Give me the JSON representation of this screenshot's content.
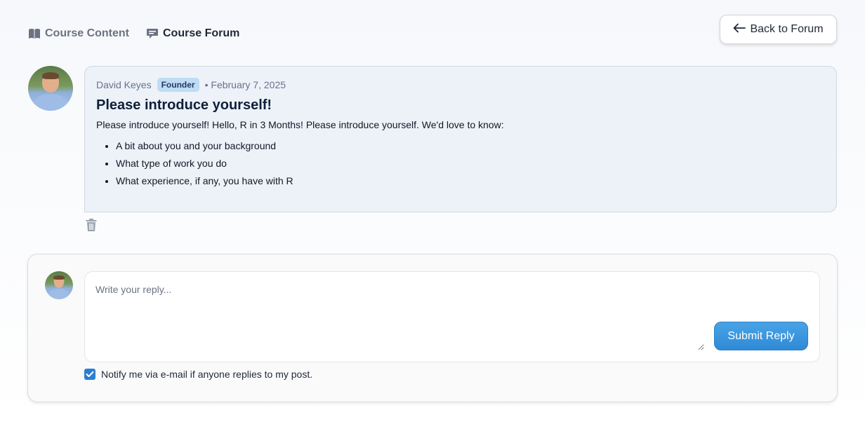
{
  "nav": {
    "course_content": "Course Content",
    "course_forum": "Course Forum",
    "back_to_forum": "Back to Forum"
  },
  "post": {
    "author": "David Keyes",
    "badge": "Founder",
    "date_separator": "•",
    "date": "February 7, 2025",
    "title": "Please introduce yourself!",
    "intro": "Please introduce yourself! Hello, R in 3 Months! Please introduce yourself. We'd love to know:",
    "bullets": [
      "A bit about you and your background",
      "What type of work you do",
      "What experience, if any, you have with R"
    ]
  },
  "reply": {
    "placeholder": "Write your reply...",
    "submit_label": "Submit Reply",
    "notify_label": "Notify me via e-mail if anyone replies to my post.",
    "notify_checked": true
  },
  "colors": {
    "accent": "#2f8ad6",
    "badge_bg": "#bfdcf5",
    "card_bg": "#edf2f8"
  },
  "icons": {
    "course_content": "book-icon",
    "course_forum": "chat-icon",
    "back": "arrow-left-icon",
    "delete": "trash-icon",
    "check": "check-icon"
  }
}
